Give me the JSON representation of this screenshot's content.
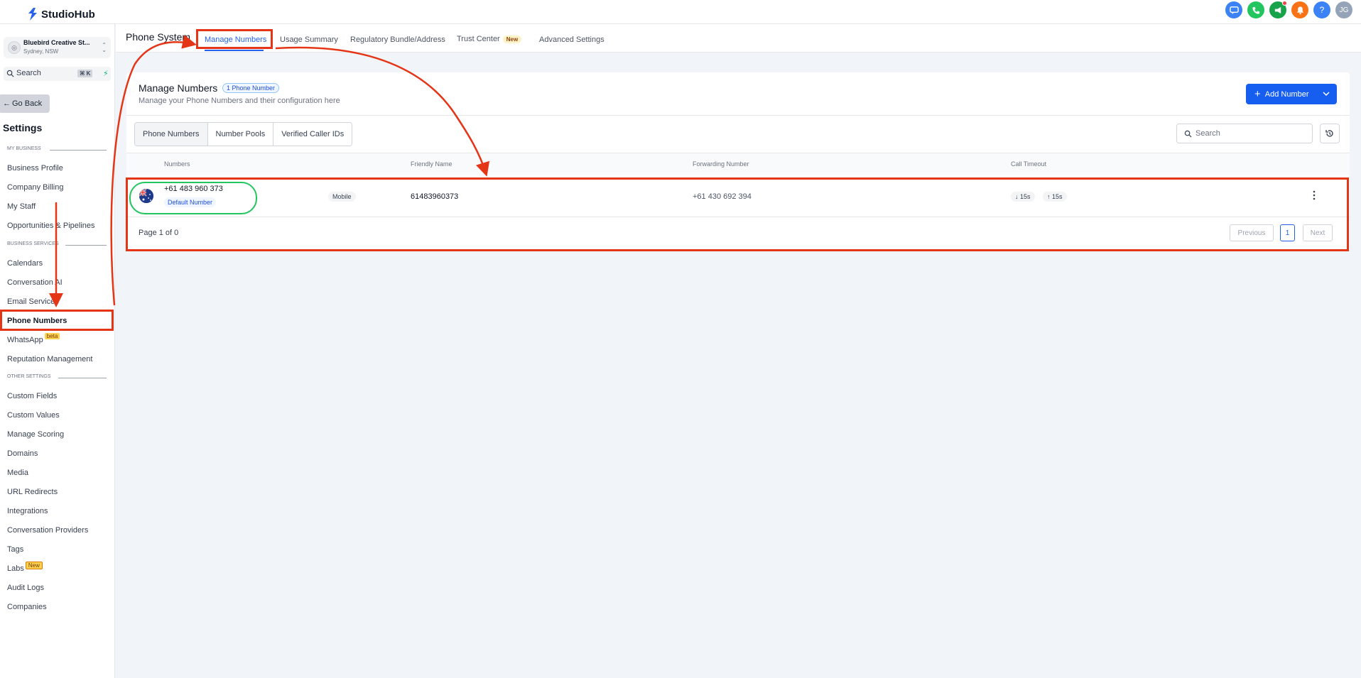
{
  "brand": {
    "name": "StudioHub",
    "accent": "#155eef"
  },
  "top_icons": [
    {
      "name": "chat-icon",
      "color": "#3b82f6"
    },
    {
      "name": "phone-icon",
      "color": "#22c55e"
    },
    {
      "name": "megaphone-icon",
      "color": "#16a34a"
    },
    {
      "name": "bell-icon",
      "color": "#f97316"
    },
    {
      "name": "help-icon",
      "color": "#3b82f6",
      "glyph": "?"
    },
    {
      "name": "avatar",
      "color": "#94a3b8",
      "glyph": "JG"
    }
  ],
  "sidebar": {
    "account_name": "Bluebird Creative St...",
    "account_location": "Sydney, NSW",
    "search_label": "Search",
    "search_shortcut": "⌘ K",
    "go_back": "Go Back",
    "title": "Settings",
    "sections": [
      {
        "label": "MY BUSINESS"
      },
      {
        "label": "BUSINESS SERVICES"
      },
      {
        "label": "OTHER SETTINGS"
      }
    ],
    "items": [
      {
        "label": "Business Profile"
      },
      {
        "label": "Company Billing"
      },
      {
        "label": "My Staff"
      },
      {
        "label": "Opportunities & Pipelines"
      },
      {
        "label": "Calendars"
      },
      {
        "label": "Conversation AI"
      },
      {
        "label": "Email Services"
      },
      {
        "label": "Phone Numbers"
      },
      {
        "label": "WhatsApp",
        "badge": "beta"
      },
      {
        "label": "Reputation Management"
      },
      {
        "label": "Custom Fields"
      },
      {
        "label": "Custom Values"
      },
      {
        "label": "Manage Scoring"
      },
      {
        "label": "Domains"
      },
      {
        "label": "Media"
      },
      {
        "label": "URL Redirects"
      },
      {
        "label": "Integrations"
      },
      {
        "label": "Conversation Providers"
      },
      {
        "label": "Tags"
      },
      {
        "label": "Labs",
        "badge": "New"
      },
      {
        "label": "Audit Logs"
      },
      {
        "label": "Companies"
      }
    ]
  },
  "header": {
    "title": "Phone System",
    "tabs": [
      {
        "label": "Manage Numbers"
      },
      {
        "label": "Usage Summary"
      },
      {
        "label": "Regulatory Bundle/Address"
      },
      {
        "label": "Trust Center",
        "badge": "New"
      },
      {
        "label": "Advanced Settings"
      }
    ]
  },
  "card": {
    "title": "Manage Numbers",
    "count_badge": "1 Phone Number",
    "subtitle": "Manage your Phone Numbers and their configuration here",
    "add_button": "Add Number",
    "segments": [
      "Phone Numbers",
      "Number Pools",
      "Verified Caller IDs"
    ],
    "search_placeholder": "Search",
    "columns": [
      "Numbers",
      "Friendly Name",
      "Forwarding Number",
      "Call Timeout"
    ],
    "row": {
      "number": "+61 483 960 373",
      "default_label": "Default Number",
      "type": "Mobile",
      "friendly_name": "61483960373",
      "forwarding": "+61 430 692 394",
      "timeout_in": "15s",
      "timeout_out": "15s"
    },
    "pagination": {
      "summary": "Page 1 of 0",
      "previous": "Previous",
      "current": "1",
      "next": "Next"
    }
  },
  "annotation_colors": {
    "red": "#e53517",
    "green": "#22c55e"
  }
}
